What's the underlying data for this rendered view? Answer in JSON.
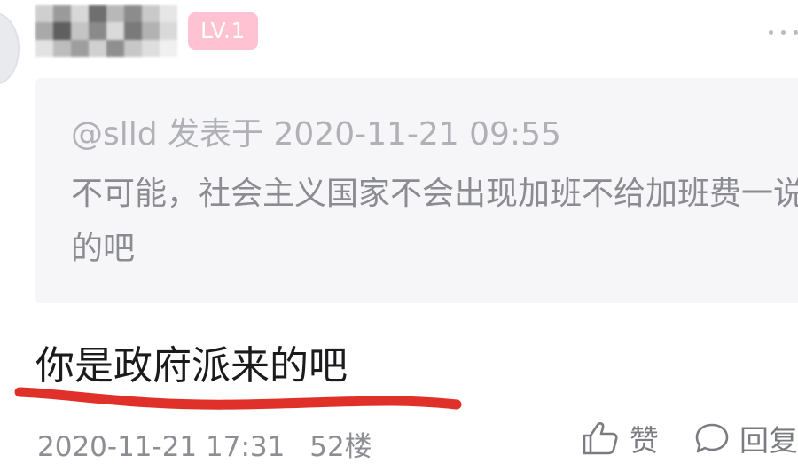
{
  "post": {
    "author_level": "LV.1",
    "quote": {
      "header": "@slld 发表于 2020-11-21 09:55",
      "text": "不可能，社会主义国家不会出现加班不给加班费一说的吧"
    },
    "comment": "你是政府派来的吧",
    "timestamp": "2020-11-21 17:31",
    "floor": "52楼",
    "actions": {
      "like_label": "赞",
      "reply_label": "回复"
    }
  },
  "icons": {
    "more": "more-icon",
    "like": "thumbs-up-icon",
    "reply": "comment-bubble-icon"
  },
  "colors": {
    "level_badge": "#ffc2d2",
    "quote_background": "#f6f6f8",
    "annotation_underline": "#e0302a"
  }
}
